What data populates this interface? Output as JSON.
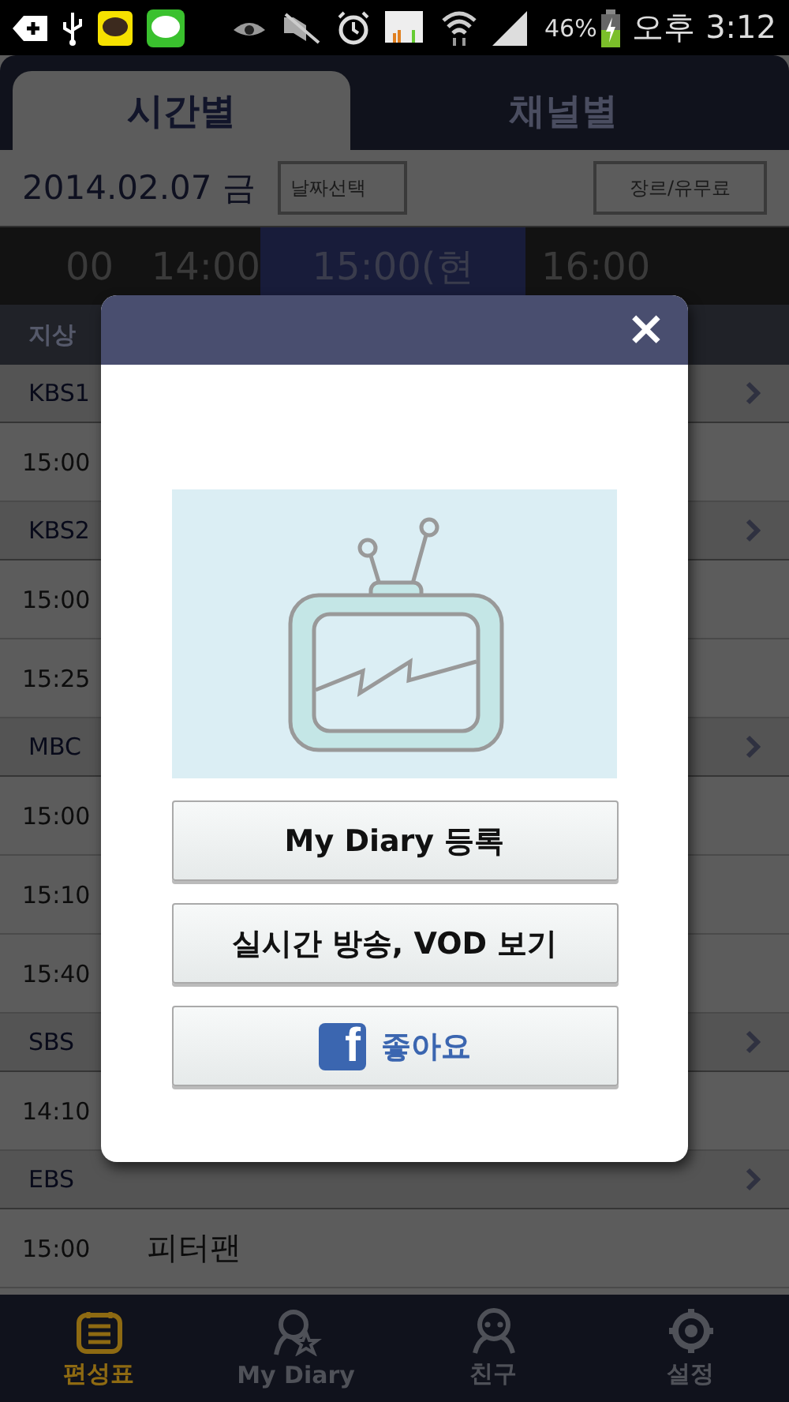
{
  "status_bar": {
    "battery": "46%",
    "time": "오후 3:12"
  },
  "tabs": [
    {
      "label": "시간별",
      "selected": true
    },
    {
      "label": "채널별",
      "selected": false
    }
  ],
  "date_bar": {
    "date": "2014.02.07 금",
    "buttons": [
      "날짜선택",
      "장르/유무료"
    ]
  },
  "time_strip": [
    {
      "label": "00",
      "selected": false
    },
    {
      "label": "14:00",
      "selected": false
    },
    {
      "label": "15:00(현",
      "selected": true
    },
    {
      "label": "16:00",
      "selected": false
    }
  ],
  "category": "지상",
  "channels": [
    {
      "name": "KBS1",
      "programs": [
        {
          "time": "15:00"
        }
      ]
    },
    {
      "name": "KBS2",
      "programs": [
        {
          "time": "15:00"
        },
        {
          "time": "15:25"
        }
      ]
    },
    {
      "name": "MBC",
      "programs": [
        {
          "time": "15:00"
        },
        {
          "time": "15:10"
        },
        {
          "time": "15:40"
        }
      ]
    },
    {
      "name": "SBS",
      "programs": [
        {
          "time": "14:10"
        }
      ]
    },
    {
      "name": "EBS",
      "programs": [
        {
          "time": "15:00",
          "title": "피터팬"
        }
      ]
    }
  ],
  "dialog": {
    "close": "×",
    "buttons": [
      {
        "kind": "text",
        "label": "My Diary 등록"
      },
      {
        "kind": "text",
        "label": "실시간 방송, VOD 보기"
      },
      {
        "kind": "facebook",
        "icon": "f",
        "label": "좋아요"
      }
    ]
  },
  "nav": [
    {
      "kind": "schedule",
      "label": "편성표",
      "selected": true
    },
    {
      "kind": "diary",
      "label": "My Diary",
      "selected": false
    },
    {
      "kind": "friend",
      "label": "친구",
      "selected": false
    },
    {
      "kind": "settings",
      "label": "설정",
      "selected": false
    }
  ]
}
